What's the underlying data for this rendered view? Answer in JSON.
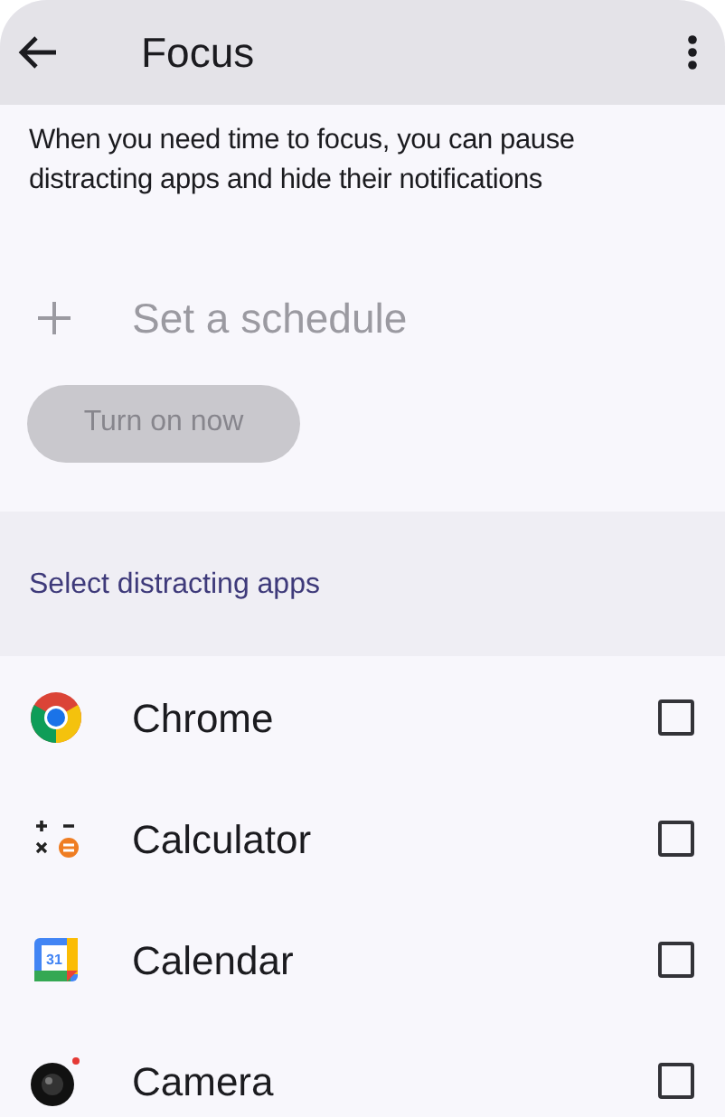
{
  "app_bar": {
    "title": "Focus"
  },
  "description": "When you need time to focus, you can pause distracting apps and hide their notifications",
  "schedule": {
    "label": "Set a schedule",
    "disabled": true
  },
  "turn_on_button": {
    "label": "Turn on now",
    "disabled": true
  },
  "section_header": "Select distracting apps",
  "apps": [
    {
      "name": "Chrome",
      "checked": false
    },
    {
      "name": "Calculator",
      "checked": false
    },
    {
      "name": "Calendar",
      "checked": false,
      "icon_text": "31"
    },
    {
      "name": "Camera",
      "checked": false
    }
  ]
}
